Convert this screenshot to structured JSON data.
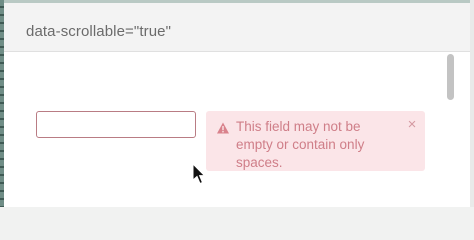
{
  "header": {
    "text": "data-scrollable=\"true\""
  },
  "form": {
    "input_value": "",
    "input_placeholder": ""
  },
  "validation": {
    "message": "This field may not be empty or contain only spaces.",
    "icon": "warning-icon",
    "close_icon": "close-icon",
    "close_glyph": "×"
  },
  "colors": {
    "error_background": "#fbe5e8",
    "error_text": "#cf7e88",
    "input_border_invalid": "#b97c84",
    "header_background": "#f3f3f3",
    "panel_background": "#ffffff"
  }
}
